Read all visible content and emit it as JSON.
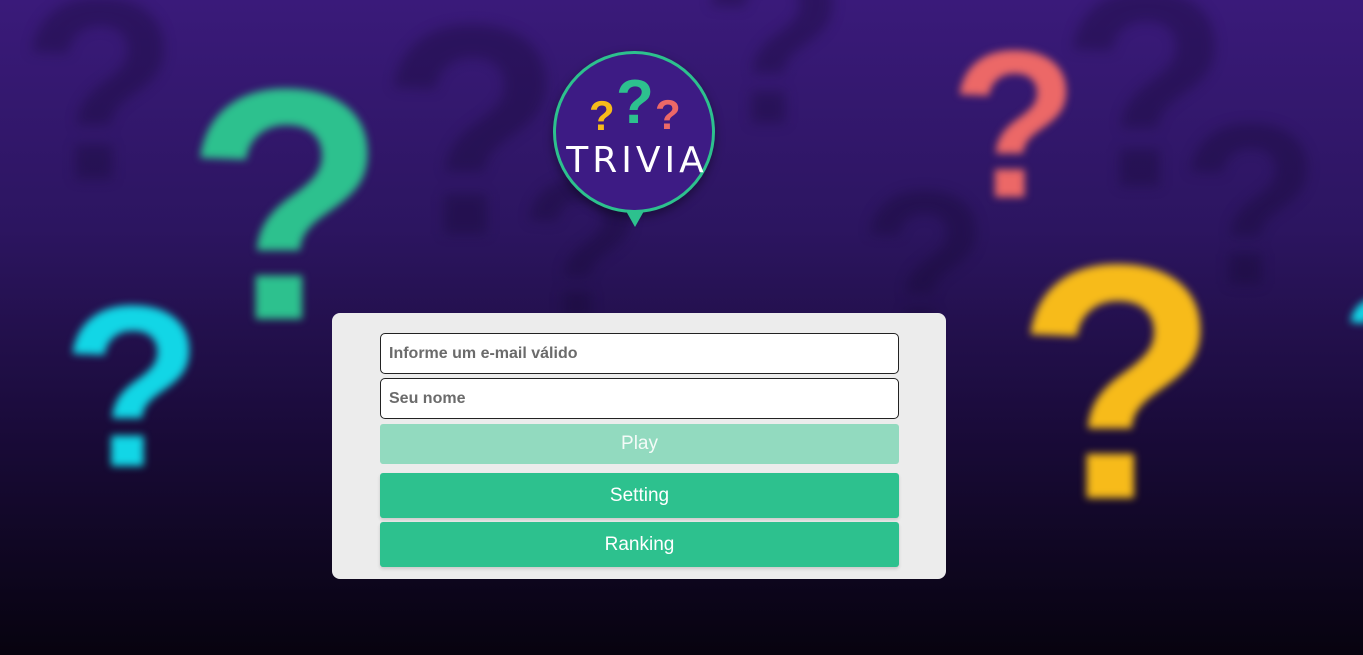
{
  "logo": {
    "text": "TRIVIA",
    "marks": [
      "?",
      "?",
      "?"
    ]
  },
  "background": {
    "marks": [
      "?",
      "?",
      "?",
      "?",
      "?",
      "?",
      "?",
      "?",
      "?",
      "?",
      "?",
      "?"
    ]
  },
  "form": {
    "email_placeholder": "Informe um e-mail válido",
    "email_value": "",
    "name_placeholder": "Seu nome",
    "name_value": "",
    "play_label": "Play",
    "play_disabled": true,
    "setting_label": "Setting",
    "ranking_label": "Ranking"
  },
  "colors": {
    "background_top": "#3a1a7a",
    "background_bottom": "#07030f",
    "accent_green": "#2dc18e",
    "disabled_green": "#92dabf",
    "yellow": "#f7bb1a",
    "coral": "#ec6867",
    "cyan": "#12d6e6",
    "logo_fill": "#3d1b84",
    "card": "#ececec"
  },
  "icons": {
    "logo": "trivia-logo-icon",
    "background": "question-mark-icon"
  }
}
